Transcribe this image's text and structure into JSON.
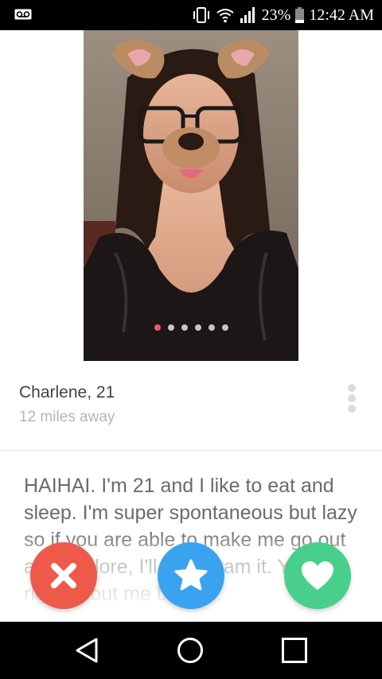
{
  "status_bar": {
    "battery": "23%",
    "time": "12:42 AM",
    "icons": [
      "voicemail-icon",
      "vibrate-icon",
      "wifi-icon",
      "signal-icon",
      "battery-icon"
    ]
  },
  "profile": {
    "name": "Charlene, 21",
    "distance": "12 miles away",
    "photo_count": 6,
    "active_photo": 1,
    "bio": "HAIHAI. I'm 21 and I like to eat and sleep. I'm super spontaneous but lazy so if you are able to make me go out and explore, I'll Instagram it. You're right about me being..."
  },
  "actions": {
    "nope": "close-icon",
    "superlike": "star-icon",
    "like": "heart-icon"
  },
  "colors": {
    "nope": "#ee5a4a",
    "superlike": "#3aa3f0",
    "like": "#48cf8b",
    "active_dot": "#f0566b"
  },
  "nav_bar": {
    "icons": [
      "back-icon",
      "home-icon",
      "recents-icon"
    ]
  }
}
